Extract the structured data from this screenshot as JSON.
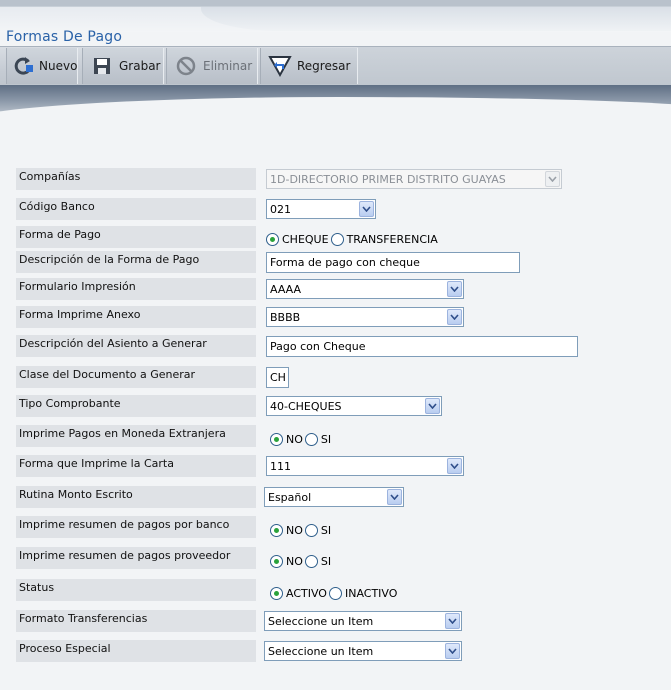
{
  "page": {
    "title": "Formas De Pago"
  },
  "toolbar": {
    "nuevo": "Nuevo",
    "grabar": "Grabar",
    "eliminar": "Eliminar",
    "regresar": "Regresar"
  },
  "form": {
    "companias": {
      "label": "Compañías",
      "value": "1D-DIRECTORIO PRIMER DISTRITO GUAYAS"
    },
    "codigo_banco": {
      "label": "Código Banco",
      "value": "021"
    },
    "forma_pago": {
      "label": "Forma de Pago",
      "opt1": "CHEQUE",
      "opt2": "TRANSFERENCIA",
      "selected": "CHEQUE"
    },
    "descripcion_forma": {
      "label": "Descripción de la Forma de Pago",
      "value": "Forma de pago con cheque"
    },
    "formulario_impresion": {
      "label": "Formulario Impresión",
      "value": "AAAA"
    },
    "forma_imprime_anexo": {
      "label": "Forma Imprime Anexo",
      "value": "BBBB"
    },
    "descripcion_asiento": {
      "label": "Descripción del Asiento a Generar",
      "value": "Pago con Cheque"
    },
    "clase_documento": {
      "label": "Clase del Documento a Generar",
      "value": "CH"
    },
    "tipo_comprobante": {
      "label": "Tipo Comprobante",
      "value": "40-CHEQUES"
    },
    "imprime_moneda_ext": {
      "label": "Imprime Pagos en Moneda Extranjera",
      "opt1": "NO",
      "opt2": "SI",
      "selected": "NO"
    },
    "forma_imprime_carta": {
      "label": "Forma que Imprime la Carta",
      "value": "111"
    },
    "rutina_monto": {
      "label": "Rutina Monto Escrito",
      "value": "Español"
    },
    "resumen_banco": {
      "label": "Imprime resumen de pagos por banco",
      "opt1": "NO",
      "opt2": "SI",
      "selected": "NO"
    },
    "resumen_proveedor": {
      "label": "Imprime resumen de pagos proveedor",
      "opt1": "NO",
      "opt2": "SI",
      "selected": "NO"
    },
    "status": {
      "label": "Status",
      "opt1": "ACTIVO",
      "opt2": "INACTIVO",
      "selected": "ACTIVO"
    },
    "formato_transferencias": {
      "label": "Formato Transferencias",
      "value": "Seleccione un Item"
    },
    "proceso_especial": {
      "label": "Proceso Especial",
      "value": "Seleccione un Item"
    }
  },
  "icons": {
    "nuevo": "new-refresh-icon",
    "grabar": "save-disk-icon",
    "eliminar": "delete-disabled-icon",
    "regresar": "back-arrow-icon",
    "dropdown": "chevron-down-icon"
  },
  "colors": {
    "title": "#2a62a8",
    "label_bg": "#dfe2e6",
    "input_border": "#7f9db9",
    "radio_dot": "#2aa23b"
  }
}
